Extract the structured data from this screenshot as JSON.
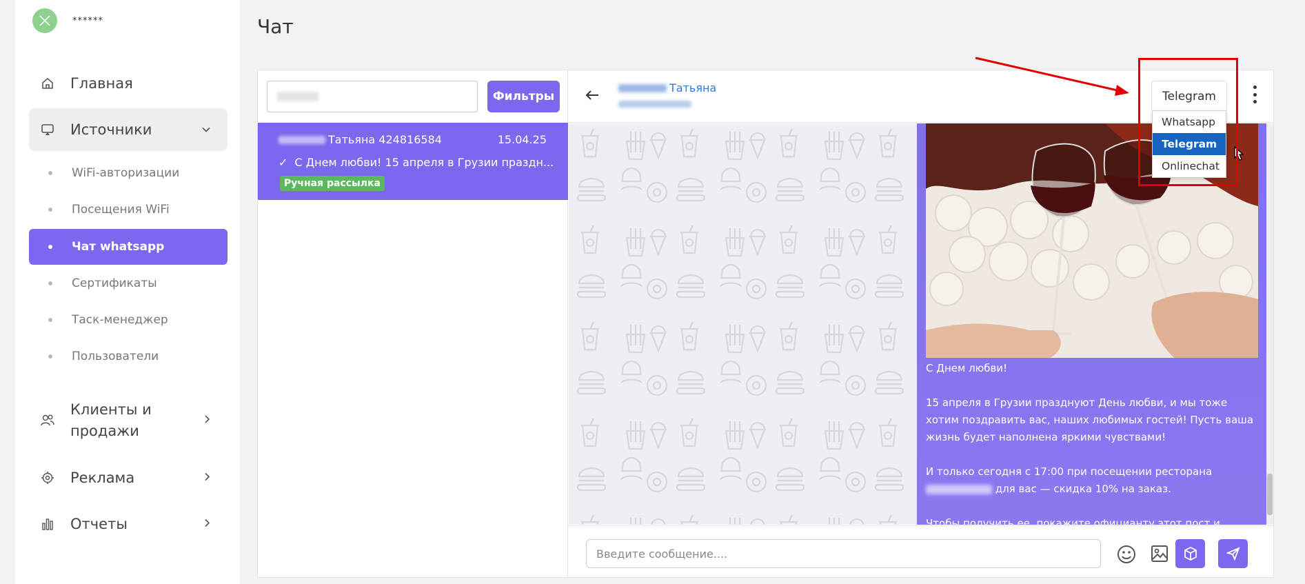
{
  "user": {
    "name": "******"
  },
  "nav": {
    "home": "Главная",
    "sources": "Источники",
    "sub_items": [
      "WiFi-авторизации",
      "Посещения WiFi",
      "Чат whatsapp",
      "Сертификаты",
      "Таск-менеджер",
      "Пользователи"
    ],
    "clients_line1": "Клиенты и",
    "clients_line2": "продажи",
    "ads": "Реклама",
    "reports": "Отчеты"
  },
  "page": {
    "title": "Чат"
  },
  "list": {
    "filters_label": "Фильтры",
    "chat": {
      "name": "Татьяна 424816584",
      "date": "15.04.25",
      "preview": "С Днем любви! 15 апреля в Грузии праздн...",
      "badge": "Ручная рассылка"
    }
  },
  "chat": {
    "contact_name": "Татьяна",
    "channel_selected": "Telegram",
    "channel_options": [
      "Whatsapp",
      "Telegram",
      "Onlinechat"
    ],
    "message": {
      "p1": "С Днем любви!",
      "p2": "15 апреля в Грузии празднуют День любви, и мы тоже хотим поздравить вас, наших любимых гостей! Пусть ваша жизнь будет наполнена яркими чувствами!",
      "p3a": "И только сегодня с 17:00 при посещении ресторана",
      "p3b": "для вас — скидка 10% на заказ.",
      "p4": "Чтобы получить ее, покажите официанту этот пост и назовите"
    },
    "input_placeholder": "Введите сообщение...."
  },
  "colors": {
    "accent": "#7b68ee",
    "badge": "#5cb85c",
    "link": "#2f7bd6",
    "annotation": "#e00000",
    "dropdown_selected": "#1565c0"
  }
}
